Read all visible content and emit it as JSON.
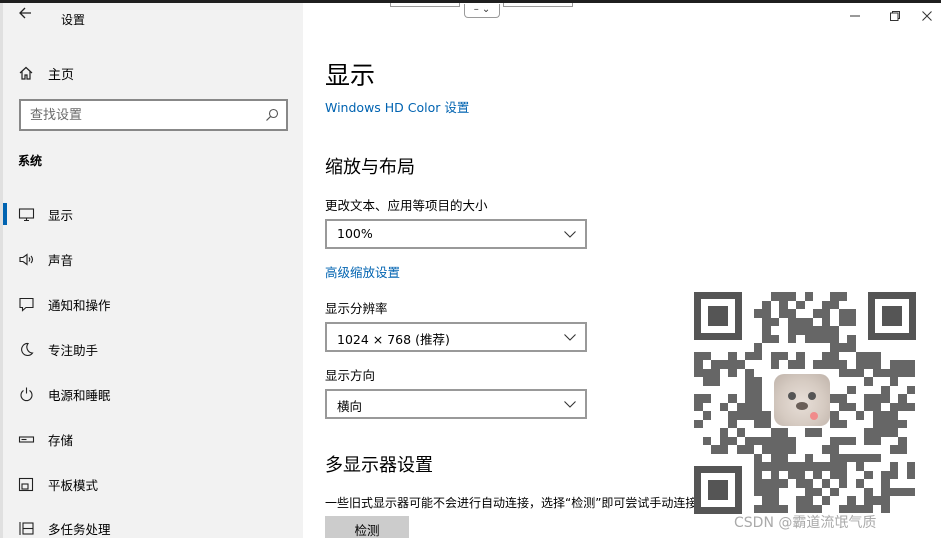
{
  "window": {
    "app_title": "设置",
    "snap_glyph": "– ⌄"
  },
  "sidebar": {
    "home_label": "主页",
    "search_placeholder": "查找设置",
    "group_title": "系统",
    "items": [
      {
        "label": "显示",
        "icon": "monitor-icon",
        "selected": true
      },
      {
        "label": "声音",
        "icon": "speaker-icon"
      },
      {
        "label": "通知和操作",
        "icon": "notification-icon"
      },
      {
        "label": "专注助手",
        "icon": "moon-icon"
      },
      {
        "label": "电源和睡眠",
        "icon": "power-icon"
      },
      {
        "label": "存储",
        "icon": "storage-icon"
      },
      {
        "label": "平板模式",
        "icon": "tablet-icon"
      },
      {
        "label": "多任务处理",
        "icon": "multitask-icon"
      }
    ]
  },
  "main": {
    "title": "显示",
    "hd_color_link": "Windows HD Color 设置",
    "scale_section": {
      "heading": "缩放与布局",
      "text_size_label": "更改文本、应用等项目的大小",
      "scale_value": "100%",
      "advanced_link": "高级缩放设置",
      "resolution_label": "显示分辨率",
      "resolution_value": "1024 × 768 (推荐)",
      "orientation_label": "显示方向",
      "orientation_value": "横向"
    },
    "multi_display": {
      "heading": "多显示器设置",
      "description": "一些旧式显示器可能不会进行自动连接，选择“检测”即可尝试手动连接。",
      "detect_button": "检测"
    }
  },
  "watermark": "CSDN @霸道流氓气质",
  "colors": {
    "accent": "#0063b1",
    "sidebar_bg": "#f2f2f2",
    "button_bg": "#cccccc"
  }
}
